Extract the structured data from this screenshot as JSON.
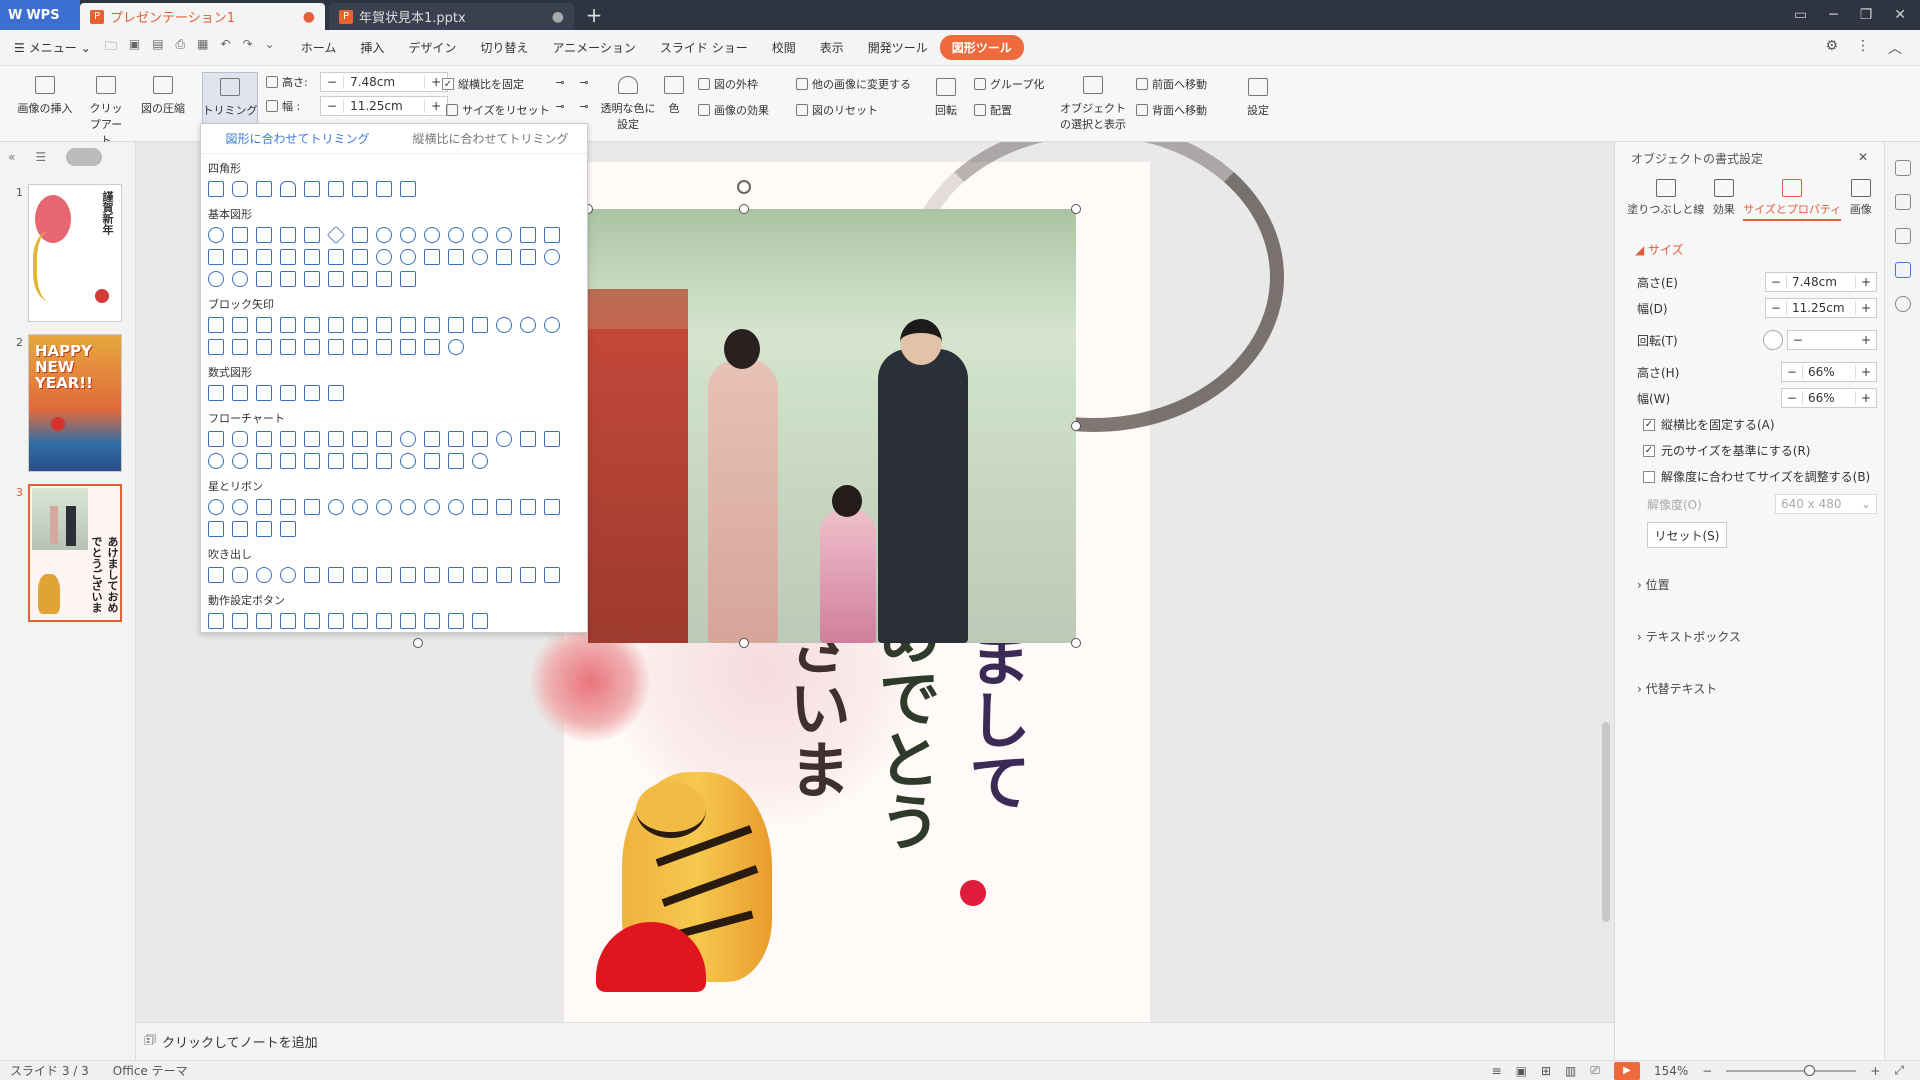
{
  "titlebar": {
    "app": "WPS",
    "tabs": [
      {
        "label": "プレゼンテーション1",
        "active": true
      },
      {
        "label": "年賀状見本1.pptx",
        "active": false
      }
    ],
    "new_tab": "+"
  },
  "menubar": {
    "menu_label": "メニュー",
    "items": [
      "ホーム",
      "挿入",
      "デザイン",
      "切り替え",
      "アニメーション",
      "スライド ショー",
      "校閲",
      "表示",
      "開発ツール",
      "図形ツール"
    ],
    "active_item": "図形ツール"
  },
  "ribbon": {
    "insert_image": "画像の挿入",
    "clip_art": "クリップアート",
    "compress": "図の圧縮",
    "trim": "トリミング",
    "height_label": "高さ:",
    "height_value": "7.48cm",
    "width_label": "幅 :",
    "width_value": "11.25cm",
    "lock_aspect": "縦横比を固定",
    "reset_size": "サイズをリセット",
    "transparent": "透明な色に設定",
    "color": "色",
    "picture_border": "図の外枠",
    "picture_effect": "画像の効果",
    "change_picture": "他の画像に変更する",
    "reset_picture": "図のリセット",
    "rotate": "回転",
    "group": "グループ化",
    "align": "配置",
    "select_show": "オブジェクトの選択と表示",
    "bring_forward": "前面へ移動",
    "send_backward": "背面へ移動",
    "settings": "設定",
    "minus": "−",
    "plus": "+"
  },
  "dropdown": {
    "tab_fit_shape": "図形に合わせてトリミング",
    "tab_fit_ratio": "縦横比に合わせてトリミング",
    "sections": [
      "四角形",
      "基本図形",
      "ブロック矢印",
      "数式図形",
      "フローチャート",
      "星とリボン",
      "吹き出し",
      "動作設定ボタン"
    ]
  },
  "slides": {
    "thumbs": [
      {
        "num": "1",
        "text": "謹賀新年"
      },
      {
        "num": "2",
        "text": "HAPPY NEW YEAR!!"
      },
      {
        "num": "3",
        "text": "あけましておめでとうございます"
      }
    ],
    "selected": "3"
  },
  "slide": {
    "calligraphy": [
      "あけまして",
      "おめでとう",
      "ございます"
    ]
  },
  "rightpanel": {
    "title": "オブジェクトの書式設定",
    "tabs": [
      "塗りつぶしと線",
      "効果",
      "サイズとプロパティ",
      "画像"
    ],
    "section_size": "サイズ",
    "height_e": "高さ(E)",
    "height_e_val": "7.48cm",
    "width_d": "幅(D)",
    "width_d_val": "11.25cm",
    "rotation": "回転(T)",
    "height_h": "高さ(H)",
    "height_h_val": "66%",
    "width_w": "幅(W)",
    "width_w_val": "66%",
    "check_lock": "縦横比を固定する(A)",
    "check_original": "元のサイズを基準にする(R)",
    "check_resolution": "解像度に合わせてサイズを調整する(B)",
    "resolution_label": "解像度(O)",
    "resolution_value": "640 x 480",
    "reset_btn": "リセット(S)",
    "position": "位置",
    "textbox": "テキストボックス",
    "alt_text": "代替テキスト"
  },
  "notebar": {
    "placeholder": "クリックしてノートを追加"
  },
  "statusbar": {
    "slide_info": "スライド 3 / 3",
    "theme": "Office テーマ",
    "zoom": "154%"
  },
  "colors": {
    "accent": "#ee6a3c",
    "titlebar": "#2f3442",
    "wps_blue": "#3d6fd0"
  }
}
